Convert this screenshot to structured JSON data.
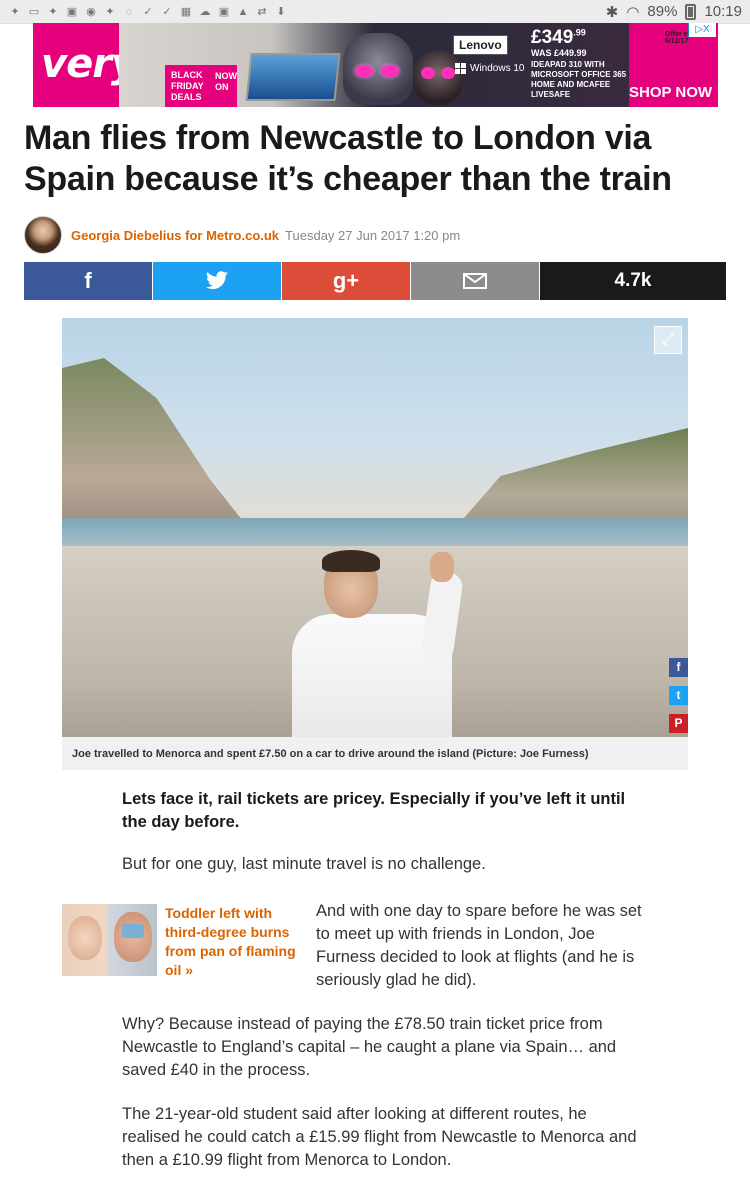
{
  "statusbar": {
    "notification_icons": [
      "twitter-icon",
      "cast-icon",
      "twitter-icon",
      "photo-icon",
      "news-icon",
      "twitter-icon",
      "messenger-icon",
      "check-icon",
      "check-icon",
      "image-icon",
      "cloud-icon",
      "photo-icon",
      "drive-icon",
      "sync-icon",
      "download-icon"
    ],
    "battery": "89%",
    "time": "10:19"
  },
  "ad": {
    "brand": "very",
    "bf_line1": "BLACK",
    "bf_line2": "FRIDAY",
    "bf_line3": "DEALS",
    "bf_now": "NOW",
    "bf_on": "ON",
    "lenovo": "Lenovo",
    "windows": "Windows 10",
    "price": "£349",
    "price_pence": ".99",
    "was": "WAS £449.99",
    "spec": "IDEAPAD 310 WITH MICROSOFT OFFICE 365 HOME AND MCAFEE LIVESAFE",
    "offer": "Offer ends 6/12/17",
    "cta": "SHOP NOW",
    "choices": "▷X"
  },
  "article": {
    "headline": "Man flies from Newcastle to London via Spain because it’s cheaper than the train",
    "author": "Georgia Diebelius for Metro.co.uk",
    "date": "Tuesday 27 Jun 2017 1:20 pm",
    "share": {
      "facebook": "f",
      "twitter": "t",
      "googleplus": "g+",
      "count": "4.7k"
    },
    "image_caption": "Joe travelled to Menorca and spent £7.50 on a car to drive around the island (Picture: Joe Furness)",
    "side_share": {
      "facebook": "f",
      "twitter": "t",
      "pinterest": "P"
    },
    "paragraphs": [
      "Lets face it, rail tickets are pricey. Especially if you’ve left it until the day before.",
      "But for one guy, last minute travel is no challenge.",
      "And with one day to spare before he was set to meet up with friends in London, Joe Furness decided to look at flights (and he is seriously glad he did).",
      "Why? Because instead of paying the £78.50 train ticket price from Newcastle to England’s capital – he caught a plane via Spain… and saved £40 in the process.",
      "The 21-year-old student said after looking at different routes, he realised he could catch a £15.99 flight from Newcastle to Menorca and then a £10.99 flight from Menorca to London."
    ],
    "related": "Toddler left with third-degree burns from pan of flaming oil »"
  }
}
